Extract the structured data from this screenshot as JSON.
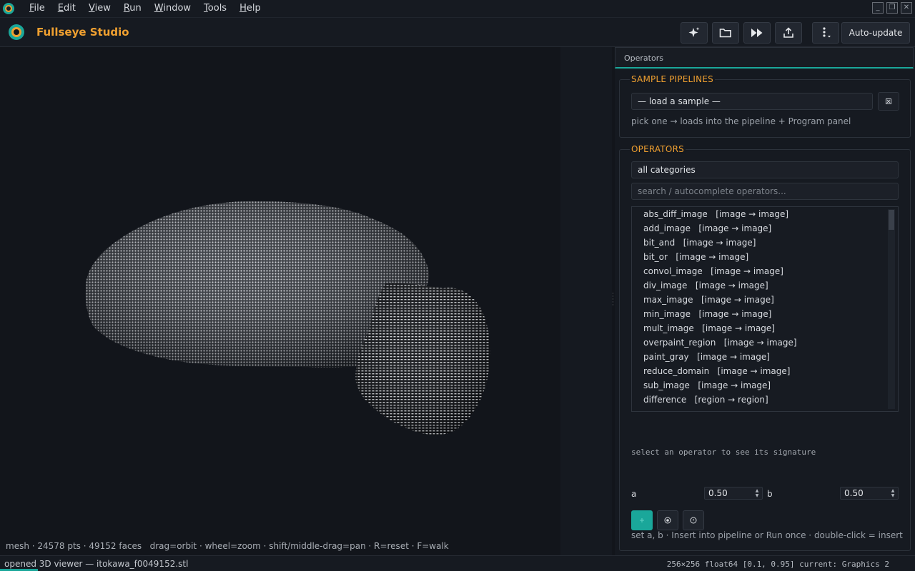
{
  "menubar": {
    "items": [
      "File",
      "Edit",
      "View",
      "Run",
      "Window",
      "Tools",
      "Help"
    ],
    "underline_first": [
      true,
      true,
      true,
      true,
      true,
      true,
      true
    ]
  },
  "header": {
    "app_title": "Fullseye Studio",
    "toolbar_icons": [
      "sparkle-icon",
      "folder-open-icon",
      "fast-forward-icon",
      "export-icon",
      "more-menu-icon"
    ],
    "auto_update_label": "Auto-update"
  },
  "viewer": {
    "hint": "mesh · 24578 pts · 49152 faces   drag=orbit · wheel=zoom · shift/middle-drag=pan · R=reset · F=walk"
  },
  "panel": {
    "tab_label": "Operators",
    "samples": {
      "title": "SAMPLE PIPELINES",
      "select_value": "— load a sample —",
      "hint": "pick one → loads into the pipeline + Program panel"
    },
    "operators": {
      "title": "OPERATORS",
      "category_value": "all categories",
      "search_placeholder": "search / autocomplete operators...",
      "items": [
        {
          "name": "abs_diff_image",
          "sig": "[image → image]"
        },
        {
          "name": "add_image",
          "sig": "[image → image]"
        },
        {
          "name": "bit_and",
          "sig": "[image → image]"
        },
        {
          "name": "bit_or",
          "sig": "[image → image]"
        },
        {
          "name": "convol_image",
          "sig": "[image → image]"
        },
        {
          "name": "div_image",
          "sig": "[image → image]"
        },
        {
          "name": "max_image",
          "sig": "[image → image]"
        },
        {
          "name": "min_image",
          "sig": "[image → image]"
        },
        {
          "name": "mult_image",
          "sig": "[image → image]"
        },
        {
          "name": "overpaint_region",
          "sig": "[image → image]"
        },
        {
          "name": "paint_gray",
          "sig": "[image → image]"
        },
        {
          "name": "reduce_domain",
          "sig": "[image → image]"
        },
        {
          "name": "sub_image",
          "sig": "[image → image]"
        },
        {
          "name": "difference",
          "sig": "[region → region]"
        }
      ],
      "signature_hint": "select an operator to see its signature",
      "param_a_label": "a",
      "param_a_value": "0.50",
      "param_b_label": "b",
      "param_b_value": "0.50",
      "footer_hint": "set a, b · Insert into pipeline or Run once · double-click = insert"
    }
  },
  "status": {
    "left": "opened 3D viewer — itokawa_f0049152.stl",
    "right": "256×256 float64 [0.1, 0.95] current: Graphics 2"
  },
  "colors": {
    "accent": "#1aa79a",
    "brand": "#f0a030",
    "background": "#12151b"
  }
}
